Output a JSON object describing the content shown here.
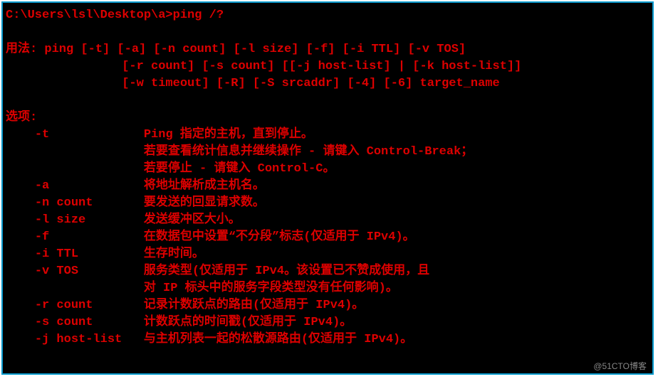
{
  "prompt": "C:\\Users\\lsl\\Desktop\\a>ping /?",
  "usage_label": "用法",
  "usage_lines": [
    "ping [-t] [-a] [-n count] [-l size] [-f] [-i TTL] [-v TOS]",
    "     [-r count] [-s count] [[-j host-list] | [-k host-list]]",
    "     [-w timeout] [-R] [-S srcaddr] [-4] [-6] target_name"
  ],
  "options_label": "选项",
  "options": [
    {
      "flag": "-t",
      "desc": "Ping 指定的主机，直到停止。"
    },
    {
      "flag": "",
      "desc": "若要查看统计信息并继续操作 - 请键入 Control-Break；"
    },
    {
      "flag": "",
      "desc": "若要停止 - 请键入 Control-C。"
    },
    {
      "flag": "-a",
      "desc": "将地址解析成主机名。"
    },
    {
      "flag": "-n count",
      "desc": "要发送的回显请求数。"
    },
    {
      "flag": "-l size",
      "desc": "发送缓冲区大小。"
    },
    {
      "flag": "-f",
      "desc": "在数据包中设置“不分段”标志(仅适用于 IPv4)。"
    },
    {
      "flag": "-i TTL",
      "desc": "生存时间。"
    },
    {
      "flag": "-v TOS",
      "desc": "服务类型(仅适用于 IPv4。该设置已不赞成使用，且"
    },
    {
      "flag": "",
      "desc": "对 IP 标头中的服务字段类型没有任何影响)。"
    },
    {
      "flag": "-r count",
      "desc": "记录计数跃点的路由(仅适用于 IPv4)。"
    },
    {
      "flag": "-s count",
      "desc": "计数跃点的时间戳(仅适用于 IPv4)。"
    },
    {
      "flag": "-j host-list",
      "desc": "与主机列表一起的松散源路由(仅适用于 IPv4)。"
    }
  ],
  "watermark": "@51CTO博客"
}
